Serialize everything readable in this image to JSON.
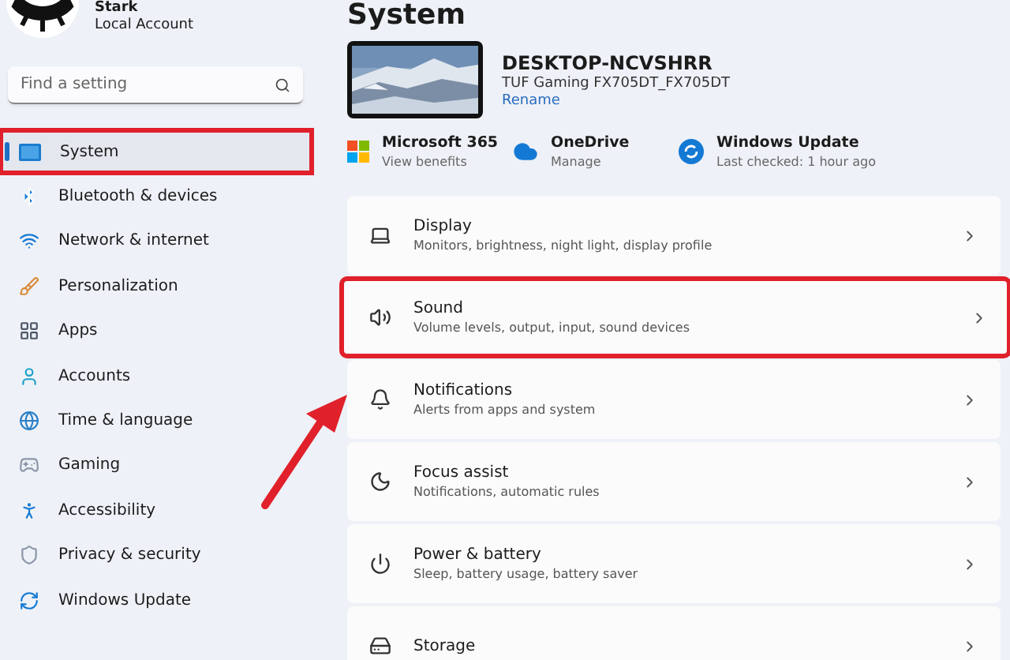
{
  "user": {
    "name": "Stark",
    "account": "Local Account"
  },
  "search": {
    "placeholder": "Find a setting"
  },
  "nav": [
    {
      "label": "System",
      "selected": true,
      "highlighted": true
    },
    {
      "label": "Bluetooth & devices",
      "selected": false,
      "highlighted": false
    },
    {
      "label": "Network & internet",
      "selected": false,
      "highlighted": false
    },
    {
      "label": "Personalization",
      "selected": false,
      "highlighted": false
    },
    {
      "label": "Apps",
      "selected": false,
      "highlighted": false
    },
    {
      "label": "Accounts",
      "selected": false,
      "highlighted": false
    },
    {
      "label": "Time & language",
      "selected": false,
      "highlighted": false
    },
    {
      "label": "Gaming",
      "selected": false,
      "highlighted": false
    },
    {
      "label": "Accessibility",
      "selected": false,
      "highlighted": false
    },
    {
      "label": "Privacy & security",
      "selected": false,
      "highlighted": false
    },
    {
      "label": "Windows Update",
      "selected": false,
      "highlighted": false
    }
  ],
  "page_title": "System",
  "device": {
    "name": "DESKTOP-NCVSHRR",
    "model": "TUF Gaming FX705DT_FX705DT",
    "rename": "Rename"
  },
  "quick_links": [
    {
      "kind": "microsoft",
      "title": "Microsoft 365",
      "subtitle": "View benefits"
    },
    {
      "kind": "onedrive",
      "title": "OneDrive",
      "subtitle": "Manage"
    },
    {
      "kind": "update",
      "title": "Windows Update",
      "subtitle": "Last checked: 1 hour ago"
    }
  ],
  "settings": [
    {
      "title": "Display",
      "subtitle": "Monitors, brightness, night light, display profile",
      "highlighted": false
    },
    {
      "title": "Sound",
      "subtitle": "Volume levels, output, input, sound devices",
      "highlighted": true
    },
    {
      "title": "Notifications",
      "subtitle": "Alerts from apps and system",
      "highlighted": false
    },
    {
      "title": "Focus assist",
      "subtitle": "Notifications, automatic rules",
      "highlighted": false
    },
    {
      "title": "Power & battery",
      "subtitle": "Sleep, battery usage, battery saver",
      "highlighted": false
    },
    {
      "title": "Storage",
      "highlighted": false
    }
  ],
  "annotation": {
    "arrow": true
  }
}
